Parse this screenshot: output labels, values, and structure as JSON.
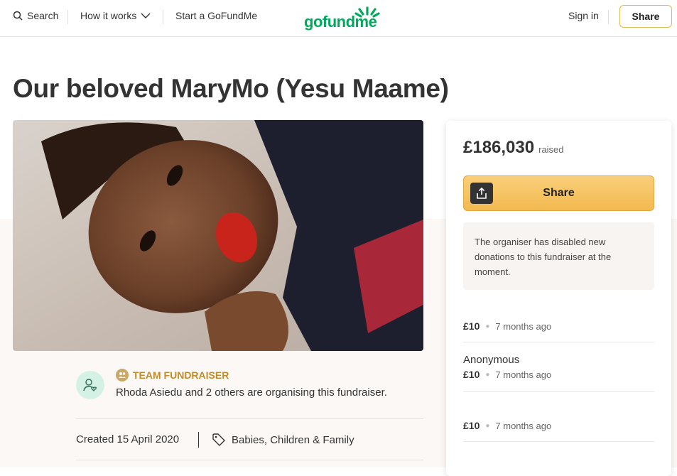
{
  "header": {
    "search_label": "Search",
    "how_it_works_label": "How it works",
    "start_label": "Start a GoFundMe",
    "logo_text": "gofundme",
    "sign_in_label": "Sign in",
    "share_label": "Share"
  },
  "page_title": "Our beloved MaryMo (Yesu Maame)",
  "organiser": {
    "team_label": "TEAM FUNDRAISER",
    "text": "Rhoda Asiedu and 2 others are organising this fundraiser.",
    "created": "Created 15 April 2020",
    "category": "Babies, Children & Family"
  },
  "sidebar": {
    "amount": "£186,030",
    "amount_suffix": "raised",
    "share_label": "Share",
    "notice": "The organiser has disabled new donations to this fundraiser at the moment.",
    "donations": [
      {
        "name": "",
        "amount": "£10",
        "time": "7 months ago"
      },
      {
        "name": "Anonymous",
        "amount": "£10",
        "time": "7 months ago"
      },
      {
        "name": "",
        "amount": "£10",
        "time": "7 months ago"
      }
    ]
  },
  "colors": {
    "brand_green": "#02a95c",
    "accent_gold": "#f3b94f",
    "team_gold": "#c38b2a"
  }
}
